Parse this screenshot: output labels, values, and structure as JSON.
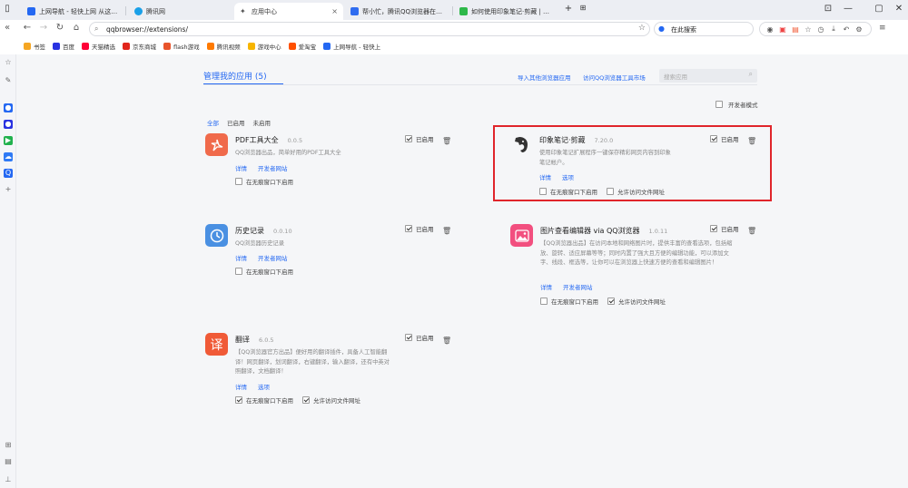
{
  "tabs": [
    {
      "label": "上网导航 - 轻快上网 从这里开始",
      "color": "#2468f2"
    },
    {
      "label": "腾讯网",
      "color": "#1aa0e8"
    },
    {
      "label": "应用中心",
      "color": "#555555",
      "active": true
    },
    {
      "label": "帮小忙，腾讯QQ浏览器在线工具箱",
      "color": "#2f6cf0"
    },
    {
      "label": "如何使用印象笔记·剪藏 | 印象笔...",
      "color": "#2eb84a"
    }
  ],
  "address": {
    "url": "qqbrowser://extensions/",
    "search_text": "在此搜索"
  },
  "bookmarks": [
    {
      "label": "书签",
      "color": "#f5a623"
    },
    {
      "label": "百度",
      "color": "#2932e1"
    },
    {
      "label": "天猫精选",
      "color": "#ff0036"
    },
    {
      "label": "京东商城",
      "color": "#e1251b"
    },
    {
      "label": "flash游戏",
      "color": "#e8542b"
    },
    {
      "label": "腾讯视频",
      "color": "#ff7a00"
    },
    {
      "label": "游戏中心",
      "color": "#f7b500"
    },
    {
      "label": "爱淘宝",
      "color": "#ff5000"
    },
    {
      "label": "上网导航 - 轻快上",
      "color": "#2468f2"
    }
  ],
  "page": {
    "title": "管理我的应用 (5)",
    "import_link": "导入其他浏览器应用",
    "store_link": "访问QQ浏览器工具市场",
    "search_placeholder": "搜索应用",
    "dev_mode": "开发者模式"
  },
  "filters": [
    "全部",
    "已启用",
    "未启用"
  ],
  "labels": {
    "enabled": "已启用",
    "details": "详情",
    "options": "选项",
    "dev_site": "开发者网站",
    "incognito": "在无痕窗口下启用",
    "file_access": "允许访问文件网址"
  },
  "extensions": [
    {
      "name": "PDF工具大全",
      "version": "0.0.5",
      "desc": "QQ浏览器出品，简单好用的PDF工具大全",
      "icon_text": "A",
      "icon_color": "#f06a4b",
      "enabled": true
    },
    {
      "name": "印象笔记·剪藏",
      "version": "7.20.0",
      "desc": "使用印象笔记扩展程序一键保存精彩网页内容到印象笔记帐户。",
      "icon_text": "🐘",
      "icon_color": "#ffffff",
      "enabled": true
    },
    {
      "name": "历史记录",
      "version": "0.0.10",
      "desc": "QQ浏览器历史记录",
      "icon_text": "◷",
      "icon_color": "#4a90e2",
      "enabled": true
    },
    {
      "name": "图片查看编辑器 via QQ浏览器",
      "version": "1.0.11",
      "desc": "【QQ浏览器出品】在访问本地和网络图片时，提供丰富的查看选项，包括缩放、旋转、适应屏幕等等；同时内置了强大且方便的编辑功能，可以添加文字、线段、框选等，让你可以在浏览器上快速方便的查看和编辑图片！",
      "icon_text": "▲",
      "icon_color": "#f24f7f",
      "enabled": true
    },
    {
      "name": "翻译",
      "version": "6.0.5",
      "desc": "【QQ浏览器官方出品】便好用的翻译插件，具备人工智能翻译！网页翻译，划词翻译，右键翻译，输入翻译，还有中英对照翻译，文档翻译！",
      "icon_text": "译",
      "icon_color": "#f05a37",
      "enabled": true
    }
  ]
}
